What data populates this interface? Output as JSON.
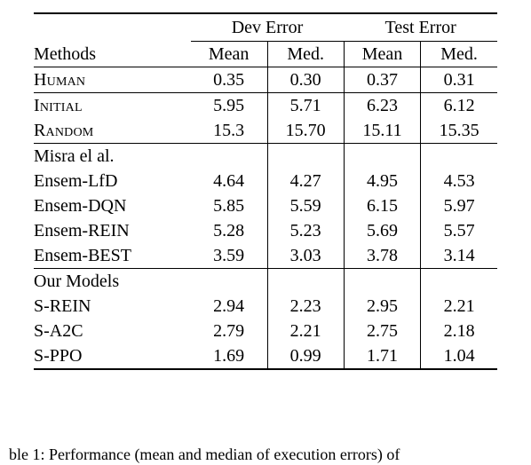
{
  "table": {
    "header": {
      "methods_label": "Methods",
      "groups": [
        {
          "label": "Dev Error",
          "subs": [
            "Mean",
            "Med."
          ]
        },
        {
          "label": "Test Error",
          "subs": [
            "Mean",
            "Med."
          ]
        }
      ]
    },
    "sections": [
      {
        "title": null,
        "rows": [
          {
            "method": "Human",
            "style": "smallcaps",
            "values": [
              "0.35",
              "0.30",
              "0.37",
              "0.31"
            ]
          }
        ]
      },
      {
        "title": null,
        "rows": [
          {
            "method": "Initial",
            "style": "smallcaps",
            "values": [
              "5.95",
              "5.71",
              "6.23",
              "6.12"
            ]
          },
          {
            "method": "Random",
            "style": "smallcaps",
            "values": [
              "15.3",
              "15.70",
              "15.11",
              "15.35"
            ]
          }
        ]
      },
      {
        "title": "Misra el al.",
        "rows": [
          {
            "method": "Ensem-LfD",
            "style": "normal",
            "values": [
              "4.64",
              "4.27",
              "4.95",
              "4.53"
            ]
          },
          {
            "method": "Ensem-DQN",
            "style": "normal",
            "values": [
              "5.85",
              "5.59",
              "6.15",
              "5.97"
            ]
          },
          {
            "method": "Ensem-REIN",
            "style": "normal",
            "values": [
              "5.28",
              "5.23",
              "5.69",
              "5.57"
            ]
          },
          {
            "method": "Ensem-BEST",
            "style": "normal",
            "values": [
              "3.59",
              "3.03",
              "3.78",
              "3.14"
            ]
          }
        ]
      },
      {
        "title": "Our Models",
        "rows": [
          {
            "method": "S-REIN",
            "style": "normal",
            "values": [
              "2.94",
              "2.23",
              "2.95",
              "2.21"
            ]
          },
          {
            "method": "S-A2C",
            "style": "normal",
            "values": [
              "2.79",
              "2.21",
              "2.75",
              "2.18"
            ]
          },
          {
            "method": "S-PPO",
            "style": "bold",
            "values": [
              "1.69",
              "0.99",
              "1.71",
              "1.04"
            ]
          }
        ]
      }
    ]
  },
  "caption": "ble 1: Performance (mean and median of execution errors) of"
}
